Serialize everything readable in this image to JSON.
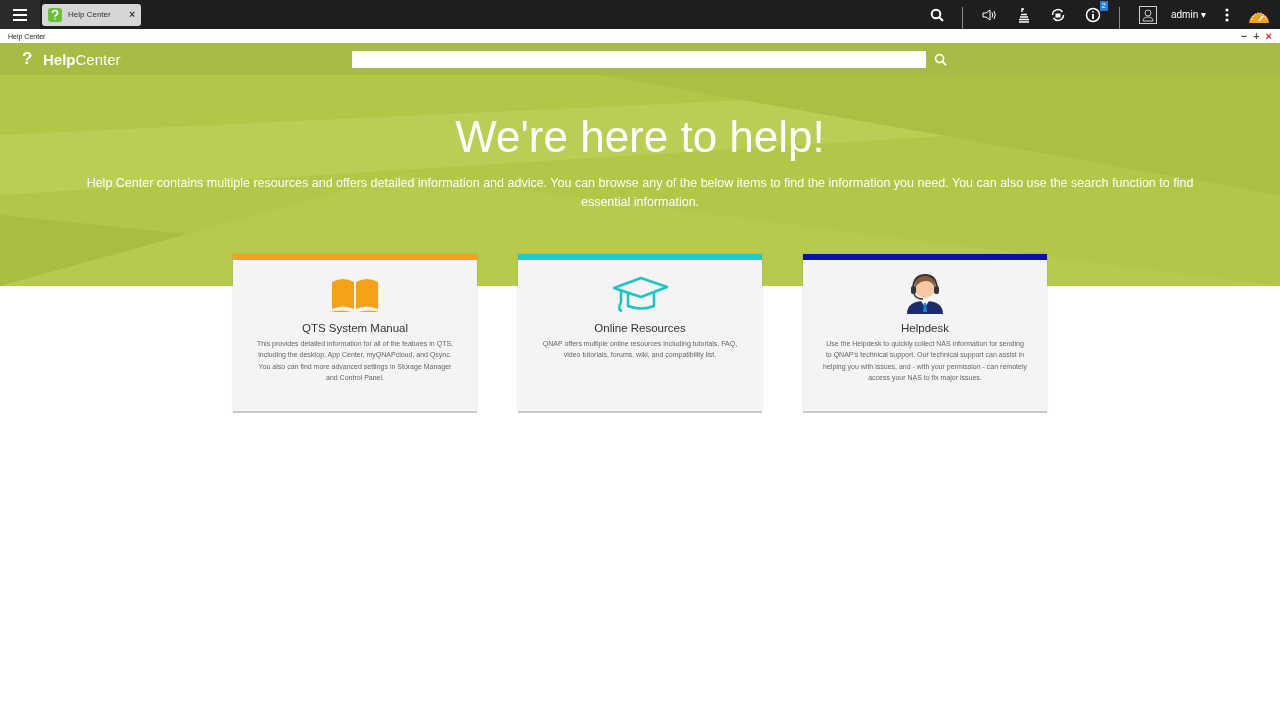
{
  "taskbar": {
    "tabs": [
      {
        "label": "Help Center",
        "close": "×",
        "selected": true
      }
    ],
    "badge": "2",
    "user": "admin",
    "user_caret": "▾"
  },
  "window": {
    "title": "Help Center",
    "controls": [
      "−",
      "+",
      "×"
    ]
  },
  "app_header": {
    "logo": "?",
    "title": "**Help**Center"
  },
  "hero": {
    "heading": "We're here to help!",
    "text": "Help Center contains multiple resources and offers detailed information and advice. You can browse any of the below items to find the information you need. You can also use the search function to find essential information."
  },
  "cards": [
    {
      "kind": "book",
      "color": "#f7a11a",
      "title": "QTS System Manual",
      "text": "This provides detailed information for all of the features in QTS, including the desktop, App Center, myQNAPcloud, and Qsync. You also can find more advanced settings in Storage Manager and Control Panel."
    },
    {
      "kind": "cap",
      "color": "#1ecbcb",
      "title": "Online Resources",
      "text": "QNAP offers multiple online resources including tutorials, FAQ, video tutorials, forums, wiki, and compatibility list."
    },
    {
      "kind": "agent",
      "color": "#0a12a8",
      "title": "Helpdesk",
      "text": "Use the Helpdesk to quickly collect NAS information for sending to QNAP's technical support. Our technical support can assist in helping you with issues, and - with your permission - can remotely access your NAS to fix major issues."
    }
  ]
}
